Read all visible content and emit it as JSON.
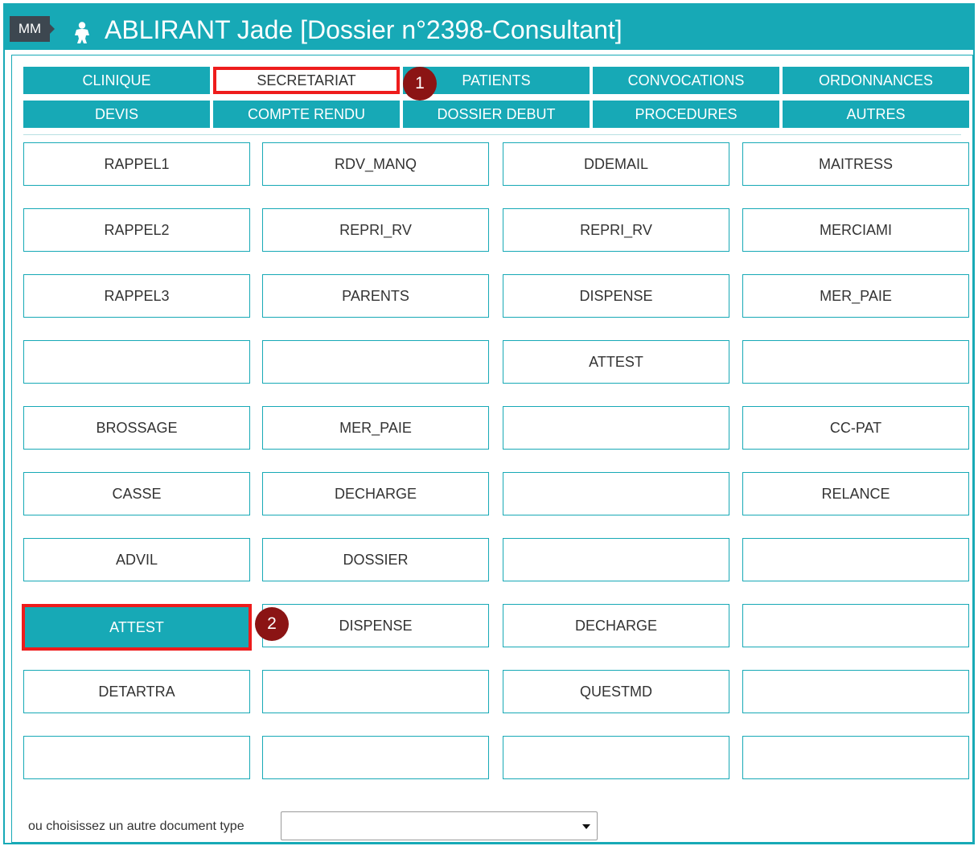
{
  "header": {
    "user_initials": "MM",
    "title": "ABLIRANT Jade [Dossier n°2398-Consultant]",
    "icon": "person-icon"
  },
  "tabs": [
    {
      "label": "CLINIQUE",
      "active": false
    },
    {
      "label": "SECRETARIAT",
      "active": true
    },
    {
      "label": "PATIENTS",
      "active": false
    },
    {
      "label": "CONVOCATIONS",
      "active": false
    },
    {
      "label": "ORDONNANCES",
      "active": false
    },
    {
      "label": "DEVIS",
      "active": false
    },
    {
      "label": "COMPTE RENDU",
      "active": false
    },
    {
      "label": "DOSSIER DEBUT",
      "active": false
    },
    {
      "label": "PROCEDURES",
      "active": false
    },
    {
      "label": "AUTRES",
      "active": false
    }
  ],
  "documents": [
    [
      "RAPPEL1",
      "RDV_MANQ",
      "DDEMAIL",
      "MAITRESS"
    ],
    [
      "RAPPEL2",
      "REPRI_RV",
      "REPRI_RV",
      "MERCIAMI"
    ],
    [
      "RAPPEL3",
      "PARENTS",
      "DISPENSE",
      "MER_PAIE"
    ],
    [
      "",
      "",
      "ATTEST",
      ""
    ],
    [
      "BROSSAGE",
      "MER_PAIE",
      "",
      "CC-PAT"
    ],
    [
      "CASSE",
      "DECHARGE",
      "",
      "RELANCE"
    ],
    [
      "ADVIL",
      "DOSSIER",
      "",
      ""
    ],
    [
      "ATTEST",
      "DISPENSE",
      "DECHARGE",
      ""
    ],
    [
      "DETARTRA",
      "",
      "QUESTMD",
      ""
    ],
    [
      "",
      "",
      "",
      ""
    ]
  ],
  "selected_document": "ATTEST",
  "step_markers": [
    "1",
    "2"
  ],
  "other_document": {
    "label": "ou choisissez un autre document type",
    "selected_value": ""
  },
  "colors": {
    "accent": "#17a9b6",
    "highlight": "#ee1c1c",
    "marker": "#8b1414",
    "badge": "#3d4750"
  }
}
